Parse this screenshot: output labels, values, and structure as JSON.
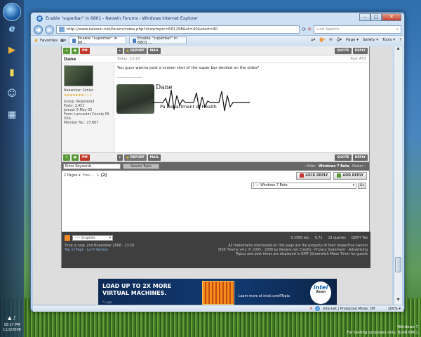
{
  "window": {
    "title": "Enable \"superbar\" in 6801 - Neowin Forums - Windows Internet Explorer",
    "address": "http://www.neowin.net/forum/index.php?showtopic=681298&st=40&start=40",
    "live_search_placeholder": "Live Search",
    "controls": {
      "minimize": "–",
      "maximize": "□",
      "close": "✕"
    }
  },
  "favorites_bar": {
    "favorites_label": "Favorites",
    "tabs": [
      {
        "label": "Enable \"superbar\" in 68..."
      },
      {
        "label": "Enable \"superbar\" in 6801 ..."
      }
    ],
    "commands": {
      "page": "Page ▾",
      "safety": "Safety ▾",
      "tools": "Tools ▾",
      "help": "?"
    }
  },
  "post_controls_top": {
    "pm": "PM",
    "report": "REPORT",
    "mail": "MAIL",
    "quote": "QUOTE",
    "reply": "REPLY"
  },
  "post": {
    "username": "Dane",
    "date": "Today, 23:19",
    "number": "Post #53",
    "body": "You guys wanna post a screen shot of the super bar docked on the sides?",
    "separator": "--------------------",
    "profile": {
      "rank": "Neowinian Senior",
      "stars": "★★★★★★★☆☆☆",
      "group": "Group: Registered",
      "posts": "Posts: 3,451",
      "joined": "Joined: 6-May 03",
      "from": "From: Lancaster County PA. USA",
      "member_no": "Member No.: 27,687"
    },
    "signature": {
      "name": "Dane",
      "dept": "Pa Department of Health"
    }
  },
  "post_controls_bottom": {
    "pm": "PM",
    "report": "REPORT",
    "mail": "MAIL",
    "quote": "QUOTE",
    "reply": "REPLY"
  },
  "search": {
    "keywords_placeholder": "Enter Keywords",
    "button": "Search Topic",
    "nav_prev": "‹ Older ·",
    "nav_current": "Windows 7 Beta",
    "nav_next": "· Newer ›"
  },
  "pagination": {
    "label": "2 Pages ▾",
    "prev": "Prev ...",
    "page1": "1",
    "page2": "[2]"
  },
  "reply_buttons": {
    "lock": "LOCK REPLY",
    "add": "ADD REPLY"
  },
  "jump": {
    "selected": "|---- Windows 7 Beta",
    "go": "Go"
  },
  "footer": {
    "skin": "----- Graphite",
    "sec": "0.1500 sec",
    "load": "0.72",
    "queries": "13 queries",
    "gzip": "GZIP? Yes",
    "time": "Time is now: 2nd November 2008 - 23:16",
    "top_links": "Top of Page · Lo-Fi Version",
    "trademark": "All trademarks mentioned on this page are the property of their respective owners",
    "shift": "Shift Theme v4.1 © 2005 - 2008 by Neowin.net Credits · Privacy Statement · Advertising",
    "tz": "Topics and post times are displayed in GMT (Greenwich Mean Time) for guests"
  },
  "ad": {
    "line1": "LOAD UP TO 2X MORE",
    "line2": "VIRTUAL MACHINES.",
    "legal": "* Legal",
    "learn": "Learn more at intel.com/ITopia",
    "logo": "intel",
    "xeon": "Xeon"
  },
  "statusbar": {
    "zone": "Internet | Protected Mode: Off",
    "zoom": "100% ▾"
  },
  "tray": {
    "time": "10:17 PM",
    "date": "11/2/2008"
  },
  "desktop_watermark": {
    "line1": "Windows 7",
    "line2": "For testing purposes only. Build 6801"
  }
}
